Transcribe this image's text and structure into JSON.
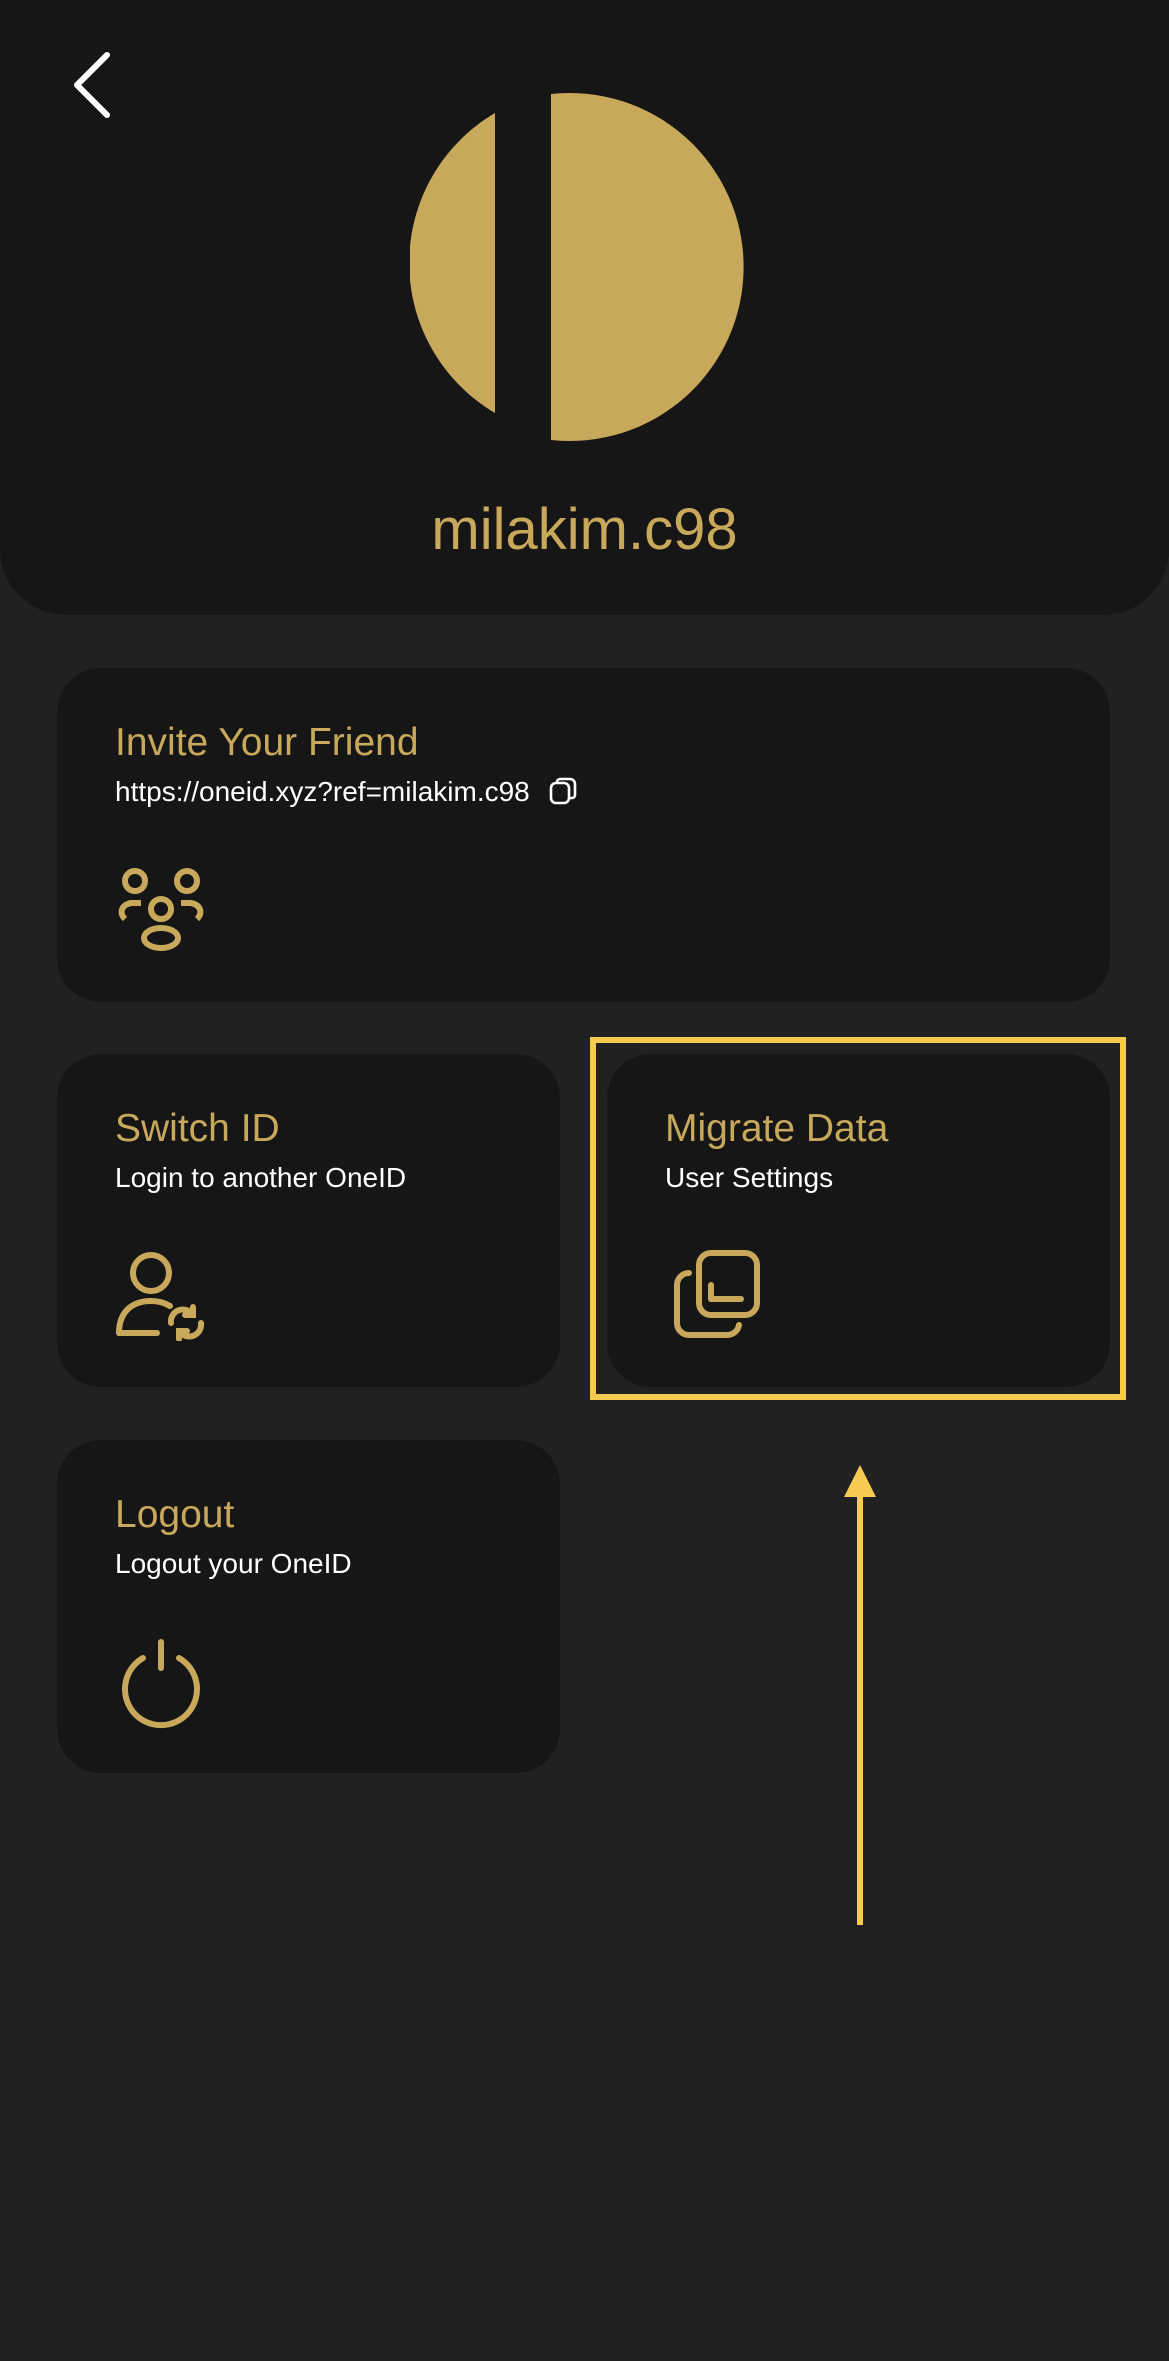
{
  "colors": {
    "background": "#212121",
    "card": "#161616",
    "gold": "#C8A85A",
    "white": "#FFFFFF",
    "highlight": "#F7CB52"
  },
  "header": {
    "back_icon": "chevron-left-icon",
    "username": "milakim.c98"
  },
  "invite_card": {
    "title": "Invite Your Friend",
    "link": "https://oneid.xyz?ref=milakim.c98",
    "copy_icon": "copy-icon",
    "icon": "group-icon"
  },
  "switch_card": {
    "title": "Switch ID",
    "subtitle": "Login to another OneID",
    "icon": "user-switch-icon"
  },
  "migrate_card": {
    "title": "Migrate Data",
    "subtitle": "User Settings",
    "icon": "layers-icon"
  },
  "logout_card": {
    "title": "Logout",
    "subtitle": "Logout your OneID",
    "icon": "power-icon"
  }
}
